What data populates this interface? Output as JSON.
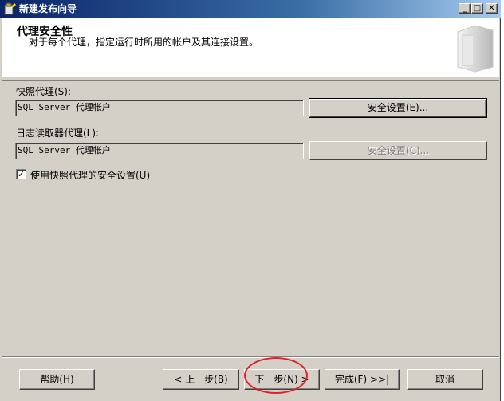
{
  "window": {
    "title": "新建发布向导",
    "icon": "wizard-icon",
    "controls": {
      "minimize": "_",
      "maximize": "□",
      "close": "✕"
    }
  },
  "header": {
    "title": "代理安全性",
    "subtitle": "对于每个代理，指定运行时所用的帐户及其连接设置。",
    "graphic": "wizard-banner-graphic"
  },
  "snapshot_agent": {
    "label": "快照代理(S):",
    "value": "SQL Server 代理帐户",
    "button": "安全设置(E)..."
  },
  "log_reader_agent": {
    "label": "日志读取器代理(L):",
    "value": "SQL Server 代理帐户",
    "button": "安全设置(C)..."
  },
  "use_snapshot_security": {
    "label": "使用快照代理的安全设置(U)",
    "checked": true,
    "mark": "✓"
  },
  "footer": {
    "help": "帮助(H)",
    "back": "< 上一步(B)",
    "next": "下一步(N) >",
    "finish": "完成(F) >>|",
    "cancel": "取消"
  },
  "colors": {
    "face": "#d4d0c8",
    "title_gradient_start": "#0a246a",
    "title_gradient_end": "#a6caf0",
    "annotation": "#e0202a"
  }
}
